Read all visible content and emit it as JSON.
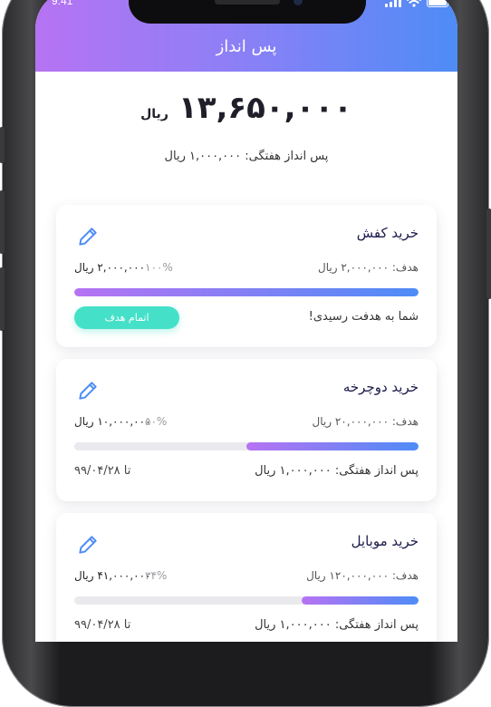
{
  "status_bar": {
    "time": "9:41"
  },
  "header": {
    "title": "پس انداز"
  },
  "summary": {
    "total_amount": "۱۳,۶۵۰,۰۰۰",
    "total_currency": "ریال",
    "weekly_label": "پس انداز هفتگی:",
    "weekly_value": "۱,۰۰۰,۰۰۰ ریال"
  },
  "goals": [
    {
      "title": "خرید کفش",
      "goal_label": "هدف:",
      "goal_value": "۲,۰۰۰,۰۰۰ ریال",
      "percent": "۱۰۰%",
      "saved": "۲,۰۰۰,۰۰۰ ریال",
      "progress": 1.0,
      "message": "شما به هدفت رسیدی!",
      "button_label": "اتمام هدف"
    },
    {
      "title": "خرید دوچرخه",
      "goal_label": "هدف:",
      "goal_value": "۲۰,۰۰۰,۰۰۰ ریال",
      "percent": "۵۰%",
      "saved": "۱۰,۰۰۰,۰۰۰ ریال",
      "progress": 0.5,
      "weekly_label": "پس انداز هفتگی:",
      "weekly_value": "۱,۰۰۰,۰۰۰ ریال",
      "deadline": "تا ۹۹/۰۴/۲۸"
    },
    {
      "title": "خرید موبایل",
      "goal_label": "هدف:",
      "goal_value": "۱۲۰,۰۰۰,۰۰۰ ریال",
      "percent": "۳۴%",
      "saved": "۴۱,۰۰۰,۰۰۰ ریال",
      "progress": 0.34,
      "weekly_label": "پس انداز هفتگی:",
      "weekly_value": "۱,۰۰۰,۰۰۰ ریال",
      "deadline": "تا ۹۹/۰۴/۲۸"
    }
  ],
  "colors": {
    "gradient_start": "#b673f3",
    "gradient_end": "#4e8cf6",
    "done_button": "#45e0c8"
  },
  "icons": {
    "edit": "pencil-icon"
  }
}
